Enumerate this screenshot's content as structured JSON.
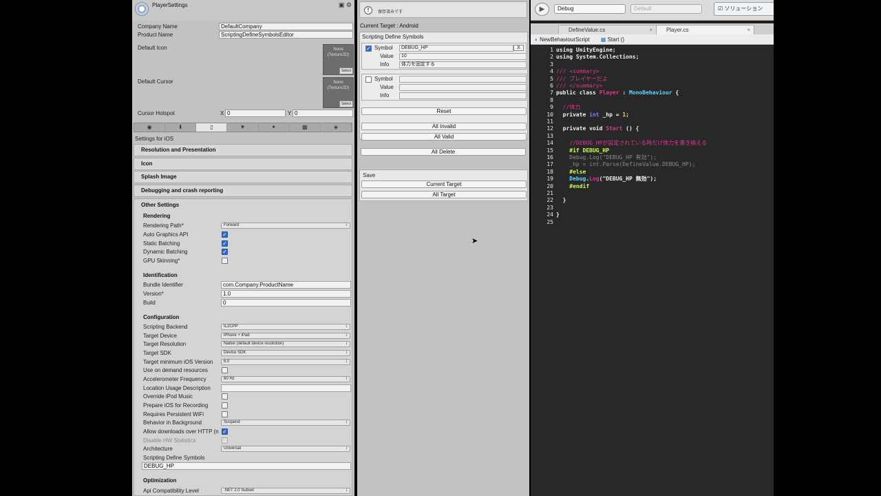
{
  "inspector": {
    "title": "PlayerSettings",
    "company_label": "Company Name",
    "company_value": "DefaultCompany",
    "product_label": "Product Name",
    "product_value": "ScriptingDefineSymbolsEditor",
    "default_icon_label": "Default Icon",
    "default_cursor_label": "Default Cursor",
    "texture_none": "None\n(Texture2D)",
    "texture_select": "Select",
    "hotspot_label": "Cursor Hotspot",
    "hotspot_x_label": "X",
    "hotspot_x": "0",
    "hotspot_y_label": "Y",
    "hotspot_y": "0",
    "platform_tabs": [
      "globe-icon",
      "standalone-icon",
      "ios-icon",
      "android-icon",
      "flash-icon",
      "html5-icon",
      "webplayer-icon"
    ],
    "settings_for": "Settings for iOS",
    "sections": [
      "Resolution and Presentation",
      "Icon",
      "Splash Image",
      "Debugging and crash reporting"
    ],
    "other_settings": "Other Settings",
    "rendering": {
      "header": "Rendering",
      "rendering_path_label": "Rendering Path*",
      "rendering_path_value": "Forward",
      "auto_graphics_label": "Auto Graphics API",
      "auto_graphics": true,
      "static_batching_label": "Static Batching",
      "static_batching": true,
      "dynamic_batching_label": "Dynamic Batching",
      "dynamic_batching": true,
      "gpu_skinning_label": "GPU Skinning*",
      "gpu_skinning": false
    },
    "identification": {
      "header": "Identification",
      "bundle_label": "Bundle Identifier",
      "bundle_value": "com.Company.ProductName",
      "version_label": "Version*",
      "version_value": "1.0",
      "build_label": "Build",
      "build_value": "0"
    },
    "configuration": {
      "header": "Configuration",
      "backend_label": "Scripting Backend",
      "backend_value": "IL2CPP",
      "device_label": "Target Device",
      "device_value": "iPhone + iPad",
      "resolution_label": "Target Resolution",
      "resolution_value": "Native (default device resolution)",
      "sdk_label": "Target SDK",
      "sdk_value": "Device SDK",
      "min_ios_label": "Target minimum iOS Version",
      "min_ios_value": "6.0",
      "on_demand_label": "Use on demand resources",
      "accel_label": "Accelerometer Frequency",
      "accel_value": "60 Hz",
      "location_label": "Location Usage Description",
      "ipod_label": "Override iPod Music",
      "prepare_label": "Prepare iOS for Recording",
      "wifi_label": "Requires Persistent WiFi",
      "background_label": "Behavior in Background",
      "background_value": "Suspend",
      "http_label": "Allow downloads over HTTP (n",
      "http": true,
      "hw_stats_label": "Disable HW Statistics",
      "arch_label": "Architecture",
      "arch_value": "Universal",
      "define_label": "Scripting Define Symbols",
      "define_value": "DEBUG_HP"
    },
    "optimization": {
      "header": "Optimization",
      "api_label": "Api Compatibility Level",
      "api_value": ".NET 2.0 Subset"
    }
  },
  "define_window": {
    "status_msg": "保存済みです",
    "current_target": "Current Target : Android",
    "box_title": "Scripting Define Symbols",
    "entries": [
      {
        "checked": true,
        "symbol_label": "Symbol",
        "symbol": "DEBUG_HP",
        "value_label": "Value",
        "value": "10",
        "info_label": "Info",
        "info": "体力を固定する",
        "remove": "X"
      },
      {
        "checked": false,
        "symbol_label": "Symbol",
        "symbol": "",
        "value_label": "Value",
        "value": "",
        "info_label": "Info",
        "info": ""
      }
    ],
    "reset": "Reset",
    "all_invalid": "All Invalid",
    "all_valid": "All Valid",
    "all_delete": "All Delete",
    "save_label": "Save",
    "save_current": "Current Target",
    "save_all": "All Target"
  },
  "editor": {
    "config": "Debug",
    "platform": "Default",
    "solution": "ソリューション",
    "tabs": [
      {
        "label": "DefineValue.cs",
        "close": "×"
      },
      {
        "label": "Player.cs",
        "close": "×"
      }
    ],
    "crumb_class": "NewBehaviourScript",
    "crumb_method": "Start ()",
    "line_numbers": [
      "1",
      "2",
      "3",
      "4",
      "5",
      "6",
      "7",
      "8",
      "9",
      "10",
      "11",
      "12",
      "13",
      "14",
      "15",
      "16",
      "17",
      "18",
      "19",
      "20",
      "21",
      "22",
      "23",
      "24",
      "25"
    ],
    "code_lines": [
      [
        {
          "t": "using UnityEngine;",
          "c": "#f2f2f2",
          "b": true
        }
      ],
      [
        {
          "t": "using System.Collections;",
          "c": "#f2f2f2",
          "b": true
        }
      ],
      [],
      [
        {
          "t": "/// <summary>",
          "c": "#e0368f"
        }
      ],
      [
        {
          "t": "/// プレイヤーだよ",
          "c": "#e0368f"
        }
      ],
      [
        {
          "t": "/// </summary>",
          "c": "#e0368f"
        }
      ],
      [
        {
          "t": "public class ",
          "c": "#f2f2f2",
          "b": true
        },
        {
          "t": "Player",
          "c": "#e0368f",
          "b": true
        },
        {
          "t": " : ",
          "c": "#f2f2f2",
          "b": true
        },
        {
          "t": "MonoBehaviour",
          "c": "#5fd7ff",
          "b": true
        },
        {
          "t": " {",
          "c": "#f2f2f2",
          "b": true
        }
      ],
      [],
      [
        {
          "t": "  //体力",
          "c": "#e0368f"
        }
      ],
      [
        {
          "t": "  private ",
          "c": "#f2f2f2",
          "b": true
        },
        {
          "t": "int",
          "c": "#8b7cf0",
          "b": true
        },
        {
          "t": " _hp = ",
          "c": "#f2f2f2",
          "b": true
        },
        {
          "t": "1",
          "c": "#ffd24a",
          "b": true
        },
        {
          "t": ";",
          "c": "#f2f2f2",
          "b": true
        }
      ],
      [],
      [
        {
          "t": "  private void ",
          "c": "#f2f2f2",
          "b": true
        },
        {
          "t": "Start",
          "c": "#e0368f",
          "b": true
        },
        {
          "t": " () {",
          "c": "#f2f2f2",
          "b": true
        }
      ],
      [],
      [
        {
          "t": "    //DEBUG_HPが設定されている時だけ体力を書き換える",
          "c": "#e0368f"
        }
      ],
      [
        {
          "t": "    #if DEBUG_HP",
          "c": "#c7ff4a",
          "b": true
        }
      ],
      [
        {
          "t": "    Debug.Log(\"DEBUG_HP 有効\");",
          "c": "#8c8c8c"
        }
      ],
      [
        {
          "t": "    _hp = int.Parse(DefineValue.DEBUG_HP);",
          "c": "#8c8c8c"
        }
      ],
      [
        {
          "t": "    #else",
          "c": "#c7ff4a",
          "b": true
        }
      ],
      [
        {
          "t": "    ",
          "c": "#f2f2f2"
        },
        {
          "t": "Debug",
          "c": "#5fd7ff",
          "b": true
        },
        {
          "t": ".",
          "c": "#f2f2f2",
          "b": true
        },
        {
          "t": "Log",
          "c": "#e0368f",
          "b": true
        },
        {
          "t": "(\"DEBUG_HP 無効\");",
          "c": "#f2f2f2",
          "b": true
        }
      ],
      [
        {
          "t": "    #endif",
          "c": "#c7ff4a",
          "b": true
        }
      ],
      [],
      [
        {
          "t": "  }",
          "c": "#f2f2f2",
          "b": true
        }
      ],
      [],
      [
        {
          "t": "}",
          "c": "#f2f2f2",
          "b": true
        }
      ],
      []
    ]
  },
  "colors": {
    "accent_check": "#3569c9",
    "code_bg": "#282828",
    "pink": "#e0368f",
    "lime": "#c7ff4a",
    "cyan": "#5fd7ff"
  }
}
